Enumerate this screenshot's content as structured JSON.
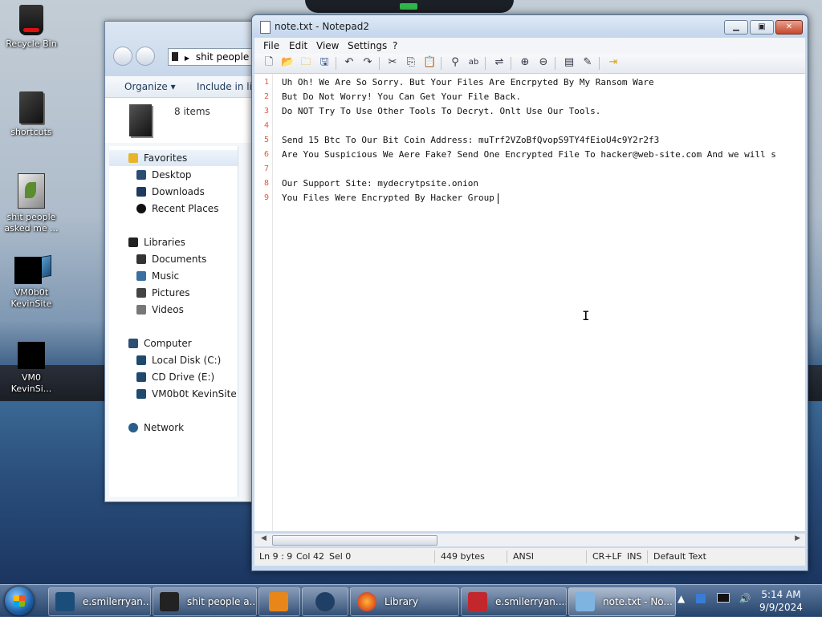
{
  "desktop": {
    "icons": [
      {
        "label": "Recycle Bin",
        "icon": "recycle-bin-icon"
      },
      {
        "label": "shortcuts",
        "icon": "folder-icon"
      },
      {
        "label": "shit people asked me ...",
        "icon": "folder-icon"
      },
      {
        "label": "VM0b0t KevinSite",
        "icon": "monitor-icon"
      },
      {
        "label": "VM0 KevinSi...",
        "icon": "app-icon"
      }
    ]
  },
  "explorer": {
    "address": "shit people a",
    "toolbar": {
      "organize": "Organize ▾",
      "include": "Include in lib"
    },
    "details": {
      "count": "8 items"
    },
    "nav": {
      "favorites": {
        "label": "Favorites",
        "items": [
          "Desktop",
          "Downloads",
          "Recent Places"
        ]
      },
      "libraries": {
        "label": "Libraries",
        "items": [
          "Documents",
          "Music",
          "Pictures",
          "Videos"
        ]
      },
      "computer": {
        "label": "Computer",
        "items": [
          "Local Disk (C:)",
          "CD Drive (E:)",
          "VM0b0t KevinSite"
        ]
      },
      "network": {
        "label": "Network"
      }
    }
  },
  "notepad": {
    "title": "note.txt - Notepad2",
    "menu": [
      "File",
      "Edit",
      "View",
      "Settings",
      "?"
    ],
    "toolbar_icons": [
      "new-icon",
      "open-icon",
      "browse-icon",
      "save-icon",
      "undo-icon",
      "redo-icon",
      "cut-icon",
      "copy-icon",
      "paste-icon",
      "find-icon",
      "replace-icon",
      "wordwrap-icon",
      "zoom-in-icon",
      "zoom-out-icon",
      "scheme-icon",
      "customize-icon",
      "exit-icon"
    ],
    "lines": [
      {
        "n": "1",
        "text": "Uh Oh! We Are So Sorry. But Your Files Are Encrpyted By My Ransom Ware"
      },
      {
        "n": "2",
        "text": "But Do Not Worry! You Can Get Your File Back."
      },
      {
        "n": "3",
        "text": "Do NOT Try To Use Other Tools To Decryt. Onlt Use Our Tools."
      },
      {
        "n": "4",
        "text": ""
      },
      {
        "n": "5",
        "text": "Send 15 Btc To Our Bit Coin Address: muTrf2VZoBfQvopS9TY4fEioU4c9Y2r2f3"
      },
      {
        "n": "6",
        "text": "Are You Suspicious We Aere Fake? Send One Encrypted File To hacker@web-site.com And we will s"
      },
      {
        "n": "7",
        "text": ""
      },
      {
        "n": "8",
        "text": "Our Support Site: mydecrytpsite.onion"
      },
      {
        "n": "9",
        "text": "You Files Were Encrypted By Hacker Group"
      }
    ],
    "status": {
      "position": "Ln 9 : 9",
      "column": "Col 42",
      "selection": "Sel 0",
      "size": "449 bytes",
      "encoding": "ANSI",
      "eol": "CR+LF",
      "mode": "INS",
      "scheme": "Default Text"
    }
  },
  "taskbar": {
    "buttons": [
      {
        "label": "e.smilerryan....",
        "color": "#1a4d7a"
      },
      {
        "label": "shit people a...",
        "color": "#222222"
      },
      {
        "label": "",
        "color": "#e8861a"
      },
      {
        "label": "",
        "color": "#1f3f66"
      },
      {
        "label": "Library",
        "color": "#e25a1c"
      },
      {
        "label": "e.smilerryan....",
        "color": "#c1272d"
      },
      {
        "label": "note.txt - No...",
        "color": "#7fb3e0"
      }
    ],
    "clock": {
      "time": "5:14 AM",
      "date": "9/9/2024"
    }
  }
}
